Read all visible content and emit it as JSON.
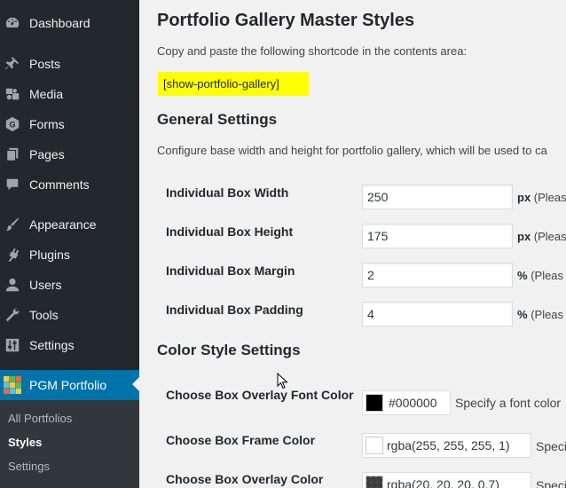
{
  "sidebar": {
    "menu": [
      {
        "label": "Dashboard",
        "icon": "dashboard-icon"
      },
      {
        "label": "Posts",
        "icon": "pushpin-icon"
      },
      {
        "label": "Media",
        "icon": "media-icon"
      },
      {
        "label": "Forms",
        "icon": "forms-icon"
      },
      {
        "label": "Pages",
        "icon": "pages-icon"
      },
      {
        "label": "Comments",
        "icon": "comment-icon"
      },
      {
        "label": "Appearance",
        "icon": "paintbrush-icon"
      },
      {
        "label": "Plugins",
        "icon": "plugin-icon"
      },
      {
        "label": "Users",
        "icon": "user-icon"
      },
      {
        "label": "Tools",
        "icon": "wrench-icon"
      },
      {
        "label": "Settings",
        "icon": "sliders-icon"
      },
      {
        "label": "PGM Portfolio",
        "icon": "portfolio-grid-icon"
      }
    ],
    "submenu": [
      {
        "label": "All Portfolios"
      },
      {
        "label": "Styles"
      },
      {
        "label": "Settings"
      }
    ]
  },
  "main": {
    "title": "Portfolio Gallery Master Styles",
    "shortcode_intro": "Copy and paste the following shortcode in the contents area:",
    "shortcode": "[show-portfolio-gallery]",
    "general": {
      "title": "General Settings",
      "description": "Configure base width and height for portfolio gallery, which will be used to ca",
      "fields": [
        {
          "label": "Individual Box Width",
          "value": "250",
          "unit": "px",
          "hint": "(Pleas"
        },
        {
          "label": "Individual Box Height",
          "value": "175",
          "unit": "px",
          "hint": "(Pleas"
        },
        {
          "label": "Individual Box Margin",
          "value": "2",
          "unit": "%",
          "hint": "(Pleas"
        },
        {
          "label": "Individual Box Padding",
          "value": "4",
          "unit": "%",
          "hint": "(Pleas"
        }
      ]
    },
    "color": {
      "title": "Color Style Settings",
      "fields": [
        {
          "label": "Choose Box Overlay Font Color",
          "value": "#000000",
          "swatch": "#000000",
          "hint": "Specify a font color"
        },
        {
          "label": "Choose Box Frame Color",
          "value": "rgba(255, 255, 255, 1)",
          "swatch": "#ffffff",
          "hint": "Speci"
        },
        {
          "label": "Choose Box Overlay Color",
          "value": "rgba(20, 20, 20, 0.7)",
          "swatch": "#3a3a3a",
          "hint": "Speci"
        }
      ]
    }
  },
  "colors": {
    "sidebar_bg": "#23282d",
    "submenu_bg": "#32373c",
    "current_menu": "#0073aa",
    "shortcode_highlight": "#ffff00"
  }
}
